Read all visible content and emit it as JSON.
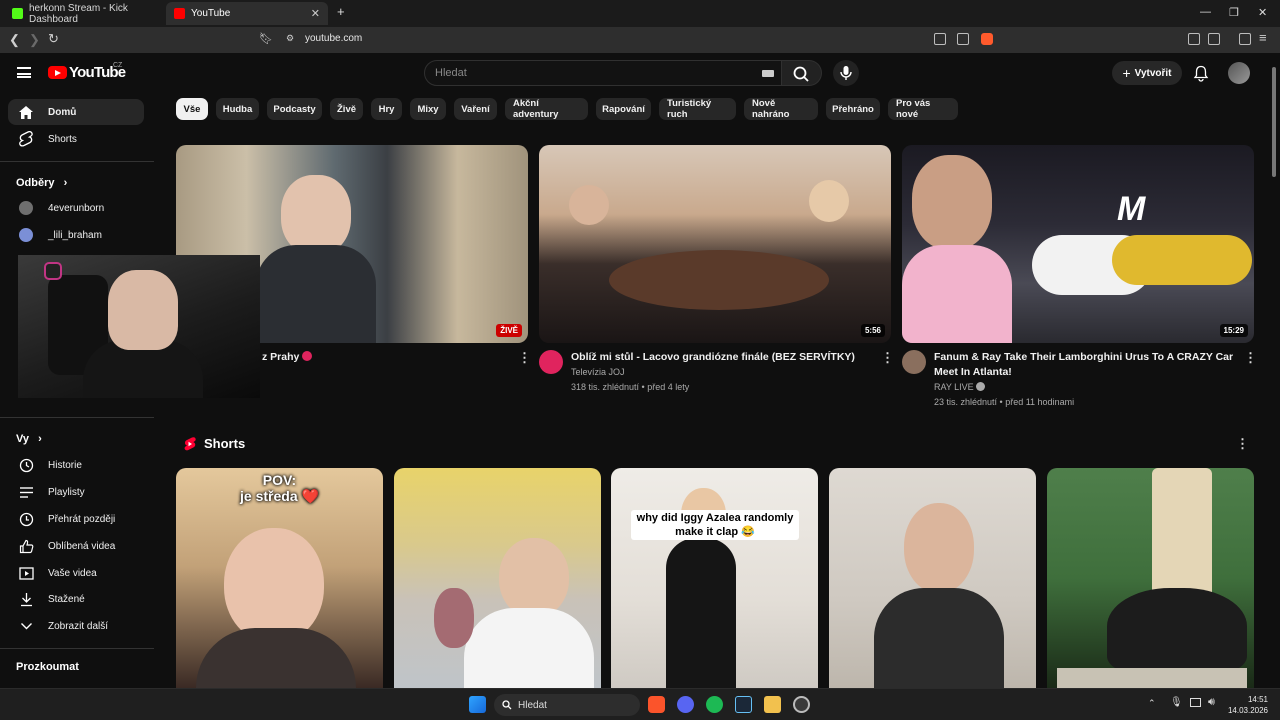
{
  "browser": {
    "tabs": [
      {
        "label": "herkonn Stream - Kick Dashboard",
        "favicon_color": "#53fc18"
      },
      {
        "label": "YouTube",
        "favicon_color": "#ff0000"
      }
    ],
    "new_tab_label": "+",
    "address": "youtube.com"
  },
  "masthead": {
    "logo_text": "YouTube",
    "country_code": "CZ",
    "search_placeholder": "Hledat",
    "create_label": "Vytvořit"
  },
  "sidebar": {
    "main": [
      {
        "label": "Domů",
        "icon": "home-icon",
        "active": true
      },
      {
        "label": "Shorts",
        "icon": "shorts-icon",
        "active": false
      }
    ],
    "subscriptions_heading": "Odběry",
    "subscriptions": [
      {
        "label": "4everunborn",
        "avatar_color": "#6f6f6f"
      },
      {
        "label": "_lili_braham",
        "avatar_color": "#7b8fd6"
      }
    ],
    "you_heading": "Vy",
    "you_items": [
      {
        "label": "Historie",
        "icon": "history-icon"
      },
      {
        "label": "Playlisty",
        "icon": "playlists-icon"
      },
      {
        "label": "Přehrát později",
        "icon": "watch-later-icon"
      },
      {
        "label": "Oblíbená videa",
        "icon": "thumbs-up-icon"
      },
      {
        "label": "Vaše videa",
        "icon": "your-videos-icon"
      },
      {
        "label": "Stažené",
        "icon": "download-icon"
      },
      {
        "label": "Zobrazit další",
        "icon": "chevron-down-icon"
      }
    ],
    "explore_heading": "Prozkoumat"
  },
  "chips": [
    "Vše",
    "Hudba",
    "Podcasty",
    "Živě",
    "Hry",
    "Mixy",
    "Vaření",
    "Akční adventury",
    "Rapování",
    "Turistický ruch",
    "Nově nahráno",
    "Přehráno",
    "Pro vás nové"
  ],
  "videos": [
    {
      "title": "z Prahy",
      "badge": "ŽIVĚ",
      "badge_type": "live"
    },
    {
      "title": "Oblíž  mi stůl - Lacovo grandiózne finále (BEZ SERVÍTKY)",
      "channel": "Televízia JOJ",
      "meta": "318 tis. zhlédnutí • před 4 lety",
      "badge": "5:56",
      "badge_type": "duration",
      "avatar_color": "#e0245e"
    },
    {
      "title": "Fanum & Ray Take Their Lamborghini Urus To A CRAZY Car Meet In Atlanta!",
      "channel": "RAY LIVE",
      "meta": "23 tis. zhlédnutí • před 11 hodinami",
      "badge": "15:29",
      "badge_type": "duration",
      "avatar_color": "#8a6f5e"
    }
  ],
  "shorts": {
    "heading": "Shorts",
    "items": [
      {
        "caption": "POV:\nje středa ❤️",
        "colors": [
          "#d9b98c",
          "#3a2a24"
        ]
      },
      {
        "caption": "",
        "colors": [
          "#e8d36a",
          "#c9c2b8"
        ]
      },
      {
        "caption": "why did Iggy Azalea randomly make it clap 😂",
        "colors": [
          "#e9e6e1",
          "#1a1a1a"
        ]
      },
      {
        "caption": "",
        "colors": [
          "#d5d2cc",
          "#2c2c2c"
        ]
      },
      {
        "caption": "",
        "colors": [
          "#3f6f3c",
          "#1a2a17"
        ]
      }
    ]
  },
  "taskbar": {
    "search_label": "Hledat",
    "time": "14:51",
    "date": "14.03.2026"
  }
}
